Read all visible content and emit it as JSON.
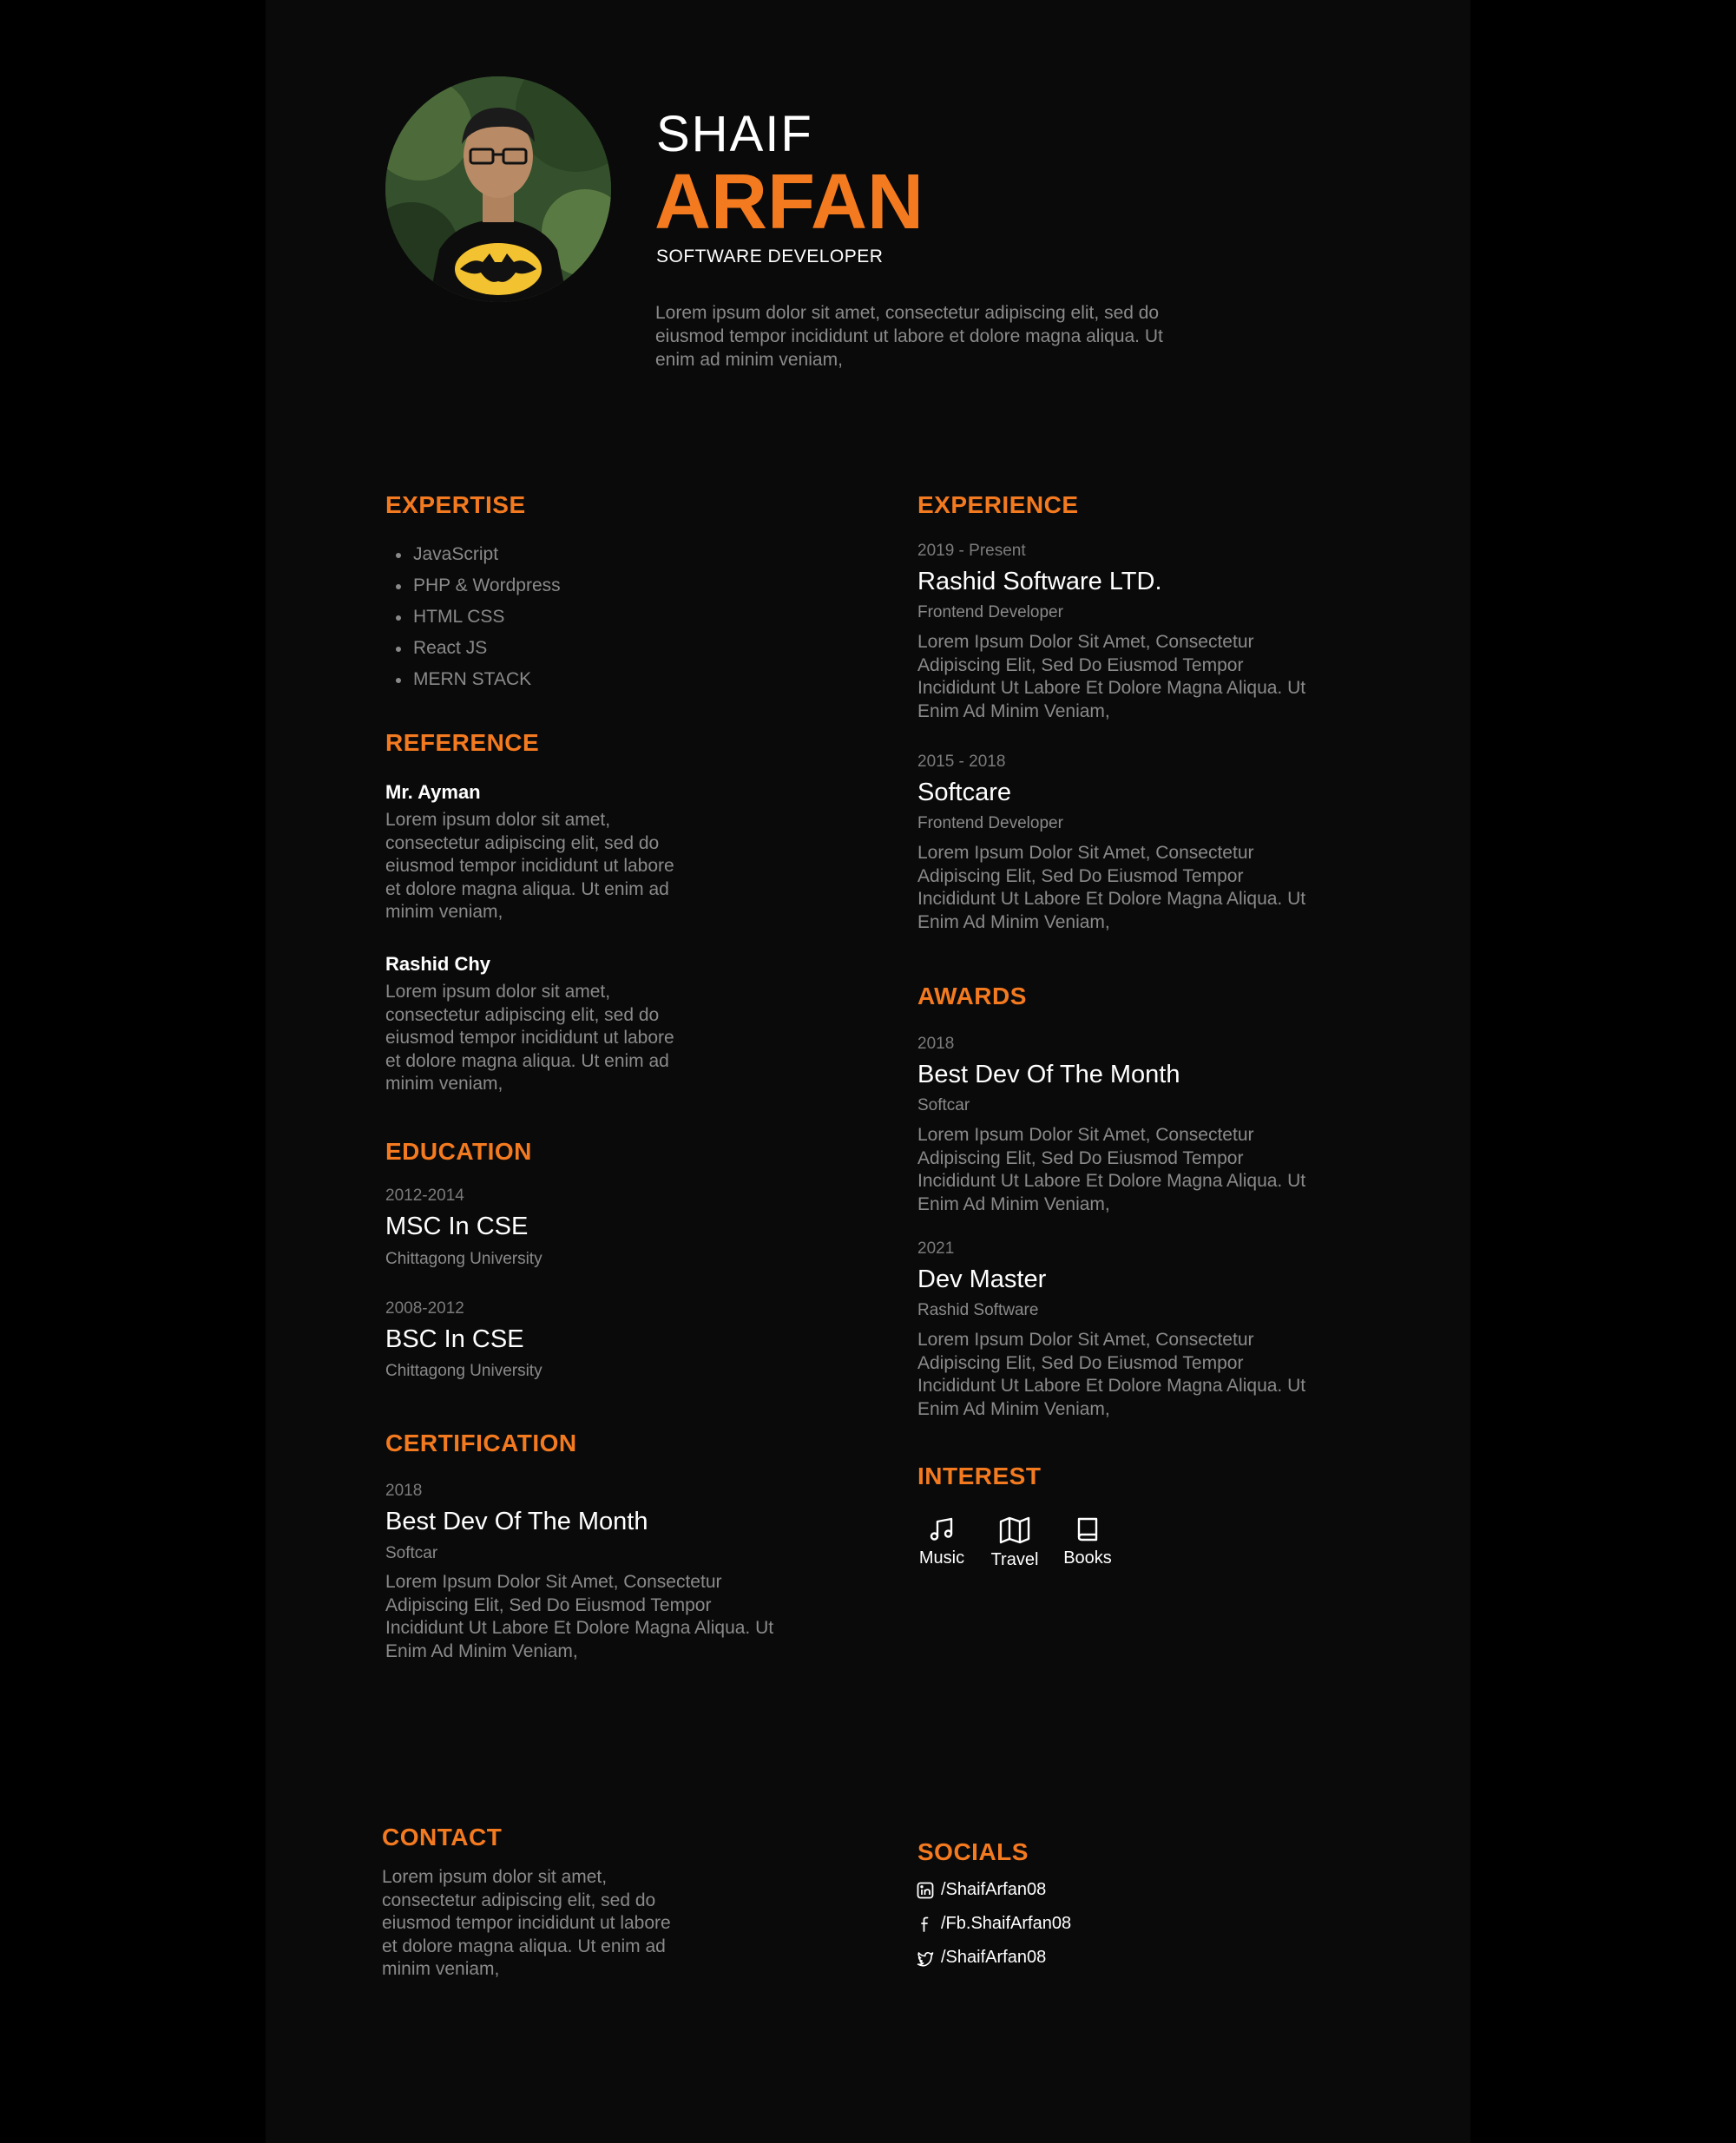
{
  "header": {
    "first_name": "SHAIF",
    "last_name": "ARFAN",
    "title": "SOFTWARE DEVELOPER",
    "bio": "Lorem ipsum dolor sit amet, consectetur adipiscing elit, sed do eiusmod tempor incididunt ut labore et dolore magna aliqua. Ut enim ad minim veniam,"
  },
  "expertise": {
    "title": "EXPERTISE",
    "skills": [
      "JavaScript",
      "PHP & Wordpress",
      "HTML CSS",
      "React JS",
      "MERN STACK"
    ]
  },
  "reference": {
    "title": "REFERENCE",
    "items": [
      {
        "name": "Mr. Ayman",
        "text": "Lorem ipsum dolor sit amet, consectetur adipiscing elit, sed do eiusmod tempor incididunt ut labore et dolore magna aliqua. Ut enim ad minim veniam,"
      },
      {
        "name": "Rashid Chy",
        "text": "Lorem ipsum dolor sit amet, consectetur adipiscing elit, sed do eiusmod tempor incididunt ut labore et dolore magna aliqua. Ut enim ad minim veniam,"
      }
    ]
  },
  "education": {
    "title": "EDUCATION",
    "items": [
      {
        "date": "2012-2014",
        "degree": "MSC In CSE",
        "school": "Chittagong University"
      },
      {
        "date": "2008-2012",
        "degree": "BSC In CSE",
        "school": "Chittagong University"
      }
    ]
  },
  "certification": {
    "title": "CERTIFICATION",
    "date": "2018",
    "name": "Best Dev Of The Month",
    "org": "Softcar",
    "text": "Lorem Ipsum Dolor Sit Amet, Consectetur Adipiscing Elit, Sed Do Eiusmod Tempor Incididunt Ut Labore Et Dolore Magna Aliqua. Ut Enim Ad Minim Veniam,"
  },
  "experience": {
    "title": "EXPERIENCE",
    "items": [
      {
        "date": "2019 - Present",
        "company": "Rashid Software LTD.",
        "role": "Frontend Developer",
        "text": "Lorem Ipsum Dolor Sit Amet, Consectetur Adipiscing Elit, Sed Do Eiusmod Tempor Incididunt Ut Labore Et Dolore Magna Aliqua. Ut Enim Ad Minim Veniam,"
      },
      {
        "date": "2015 - 2018",
        "company": "Softcare",
        "role": "Frontend Developer",
        "text": "Lorem Ipsum Dolor Sit Amet, Consectetur Adipiscing Elit, Sed Do Eiusmod Tempor Incididunt Ut Labore Et Dolore Magna Aliqua. Ut Enim Ad Minim Veniam,"
      }
    ]
  },
  "awards": {
    "title": "AWARDS",
    "items": [
      {
        "date": "2018",
        "name": "Best Dev Of The Month",
        "org": "Softcar",
        "text": "Lorem Ipsum Dolor Sit Amet, Consectetur Adipiscing Elit, Sed Do Eiusmod Tempor Incididunt Ut Labore Et Dolore Magna Aliqua. Ut Enim Ad Minim Veniam,"
      },
      {
        "date": "2021",
        "name": "Dev Master",
        "org": "Rashid Software",
        "text": "Lorem Ipsum Dolor Sit Amet, Consectetur Adipiscing Elit, Sed Do Eiusmod Tempor Incididunt Ut Labore Et Dolore Magna Aliqua. Ut Enim Ad Minim Veniam,"
      }
    ]
  },
  "interest": {
    "title": "INTEREST",
    "items": [
      {
        "label": "Music",
        "icon": "music-note-icon"
      },
      {
        "label": "Travel",
        "icon": "map-icon"
      },
      {
        "label": "Books",
        "icon": "book-icon"
      }
    ]
  },
  "contact": {
    "title": "CONTACT",
    "text": "Lorem ipsum dolor sit amet, consectetur adipiscing elit, sed do eiusmod tempor incididunt ut labore et dolore magna aliqua. Ut enim ad minim veniam,"
  },
  "socials": {
    "title": "SOCIALS",
    "items": [
      {
        "icon": "linkedin-icon",
        "handle": "/ShaifArfan08"
      },
      {
        "icon": "facebook-icon",
        "handle": "/Fb.ShaifArfan08"
      },
      {
        "icon": "twitter-icon",
        "handle": "/ShaifArfan08"
      }
    ]
  },
  "colors": {
    "accent": "#f47a20",
    "page_background": "#0a0a0a",
    "outer_background": "#000000"
  }
}
